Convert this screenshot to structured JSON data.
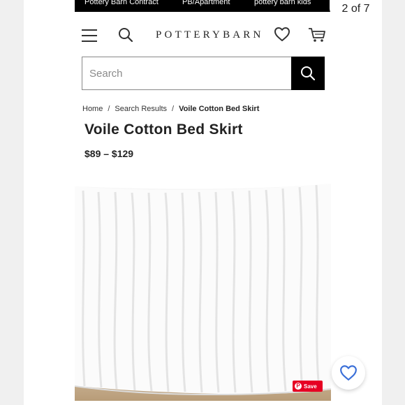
{
  "top_links": [
    "Pottery Barn Contract",
    "PB/Apartment",
    "pottery barn kids"
  ],
  "counter": "2 of 7",
  "brand": {
    "logo": "POTTERYBARN"
  },
  "search": {
    "placeholder": "Search"
  },
  "breadcrumb": {
    "home": "Home",
    "sep1": "/",
    "results": "Search Results",
    "sep2": "/",
    "current": "Voile Cotton Bed Skirt"
  },
  "product": {
    "title": "Voile Cotton Bed Skirt",
    "price": "$89 – $129"
  },
  "pin": {
    "save_label": "Save"
  },
  "colors": {
    "brand_black": "#000000",
    "pinterest_red": "#e60023",
    "fab_heart": "#3a6fd8"
  },
  "icons": [
    "hamburger-icon",
    "search-icon",
    "heart-icon",
    "cart-icon",
    "pinterest-icon",
    "heart-outline-icon"
  ]
}
